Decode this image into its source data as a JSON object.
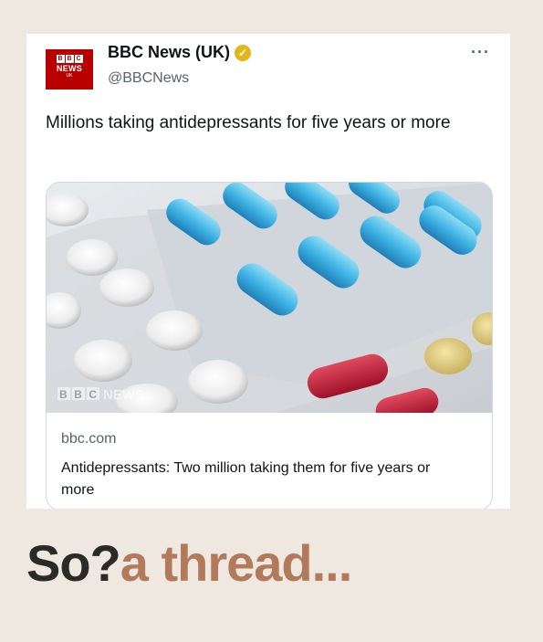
{
  "tweet": {
    "logo": {
      "letters": [
        "B",
        "B",
        "C"
      ],
      "word": "NEWS",
      "region": "UK"
    },
    "author_name": "BBC News (UK)",
    "verified_icon": "verified-badge-icon",
    "handle": "@BBCNews",
    "more_label": "···",
    "text": "Millions taking antidepressants for five years or more",
    "card": {
      "image_watermark": "BBC NEWS",
      "domain": "bbc.com",
      "title": "Antidepressants: Two million taking them for five years or more"
    }
  },
  "caption": {
    "part1": "So?",
    "part2": "a thread..."
  },
  "colors": {
    "background": "#efe8e1",
    "bbc_red": "#b80000",
    "verified_gold": "#e2b719",
    "caption_dark": "#2c2a27",
    "caption_accent": "#b17a5a"
  }
}
